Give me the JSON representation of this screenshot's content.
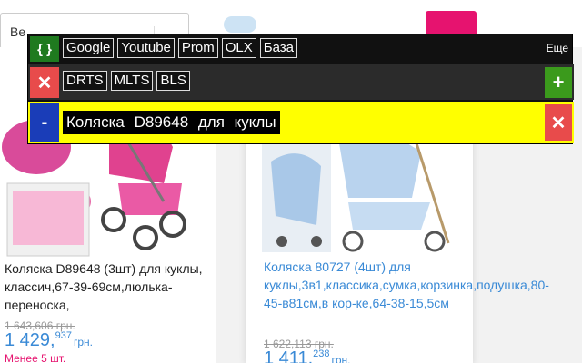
{
  "page": {
    "search_text": "Ве",
    "cards": [
      {
        "title": "Коляска D89648 (3шт) для куклы, классич,67-39-69см,люлька-переноска,",
        "old_price": "1 643,606 грн.",
        "price_main": "1 429,",
        "price_cents": "937",
        "currency": "грн.",
        "stock": "Менее 5 шт."
      },
      {
        "title": "Коляска 80727 (4шт) для куклы,3в1,классика,сумка,корзинка,подушка,80-45-в81см,в кор-ке,64-38-15,5см",
        "old_price": "1 622,113 грн.",
        "price_main": "1 411,",
        "price_cents": "238",
        "currency": "грн."
      }
    ]
  },
  "extension": {
    "row1": {
      "braces": "{ }",
      "links": [
        "Google",
        "Youtube",
        "Prom",
        "OLX",
        "База"
      ],
      "more": "Еще"
    },
    "row2": {
      "close": "✕",
      "links": [
        "DRTS",
        "MLTS",
        "BLS"
      ],
      "add": "+"
    },
    "row3": {
      "minus": "-",
      "query": "Коляска D89648 для куклы",
      "clear": "✕"
    }
  },
  "colors": {
    "accent_pink": "#e6136f",
    "link_blue": "#3a8ad6",
    "query_bg": "#ffff00"
  }
}
